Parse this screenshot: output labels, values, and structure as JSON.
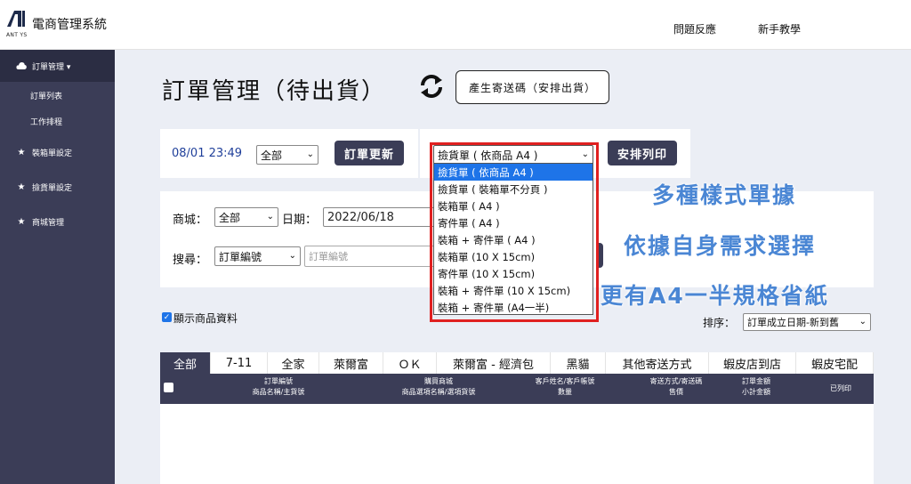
{
  "app": {
    "title": "電商管理系統",
    "logo_sub": "ANT YS",
    "top_links": [
      "問題反應",
      "新手教學"
    ]
  },
  "sidebar": {
    "items": [
      {
        "label": "訂單管理 ▾",
        "icon": "cloud-icon"
      },
      {
        "label": "訂單列表"
      },
      {
        "label": "工作排程"
      },
      {
        "label": "裝箱單設定",
        "icon": "star-icon"
      },
      {
        "label": "撿貨單設定",
        "icon": "star-icon"
      },
      {
        "label": "商城管理",
        "icon": "star-icon"
      }
    ]
  },
  "page": {
    "title": "訂單管理（待出貨）",
    "generate_button": "產生寄送碼（安排出貨）"
  },
  "update_panel": {
    "time": "08/01 23:49",
    "filter_value": "全部",
    "update_button": "訂單更新",
    "sheet_select_value": "撿貨單 ( 依商品 A4 )",
    "print_button": "安排列印"
  },
  "sheet_options": [
    "撿貨單 ( 依商品 A4 )",
    "撿貨單 ( 裝箱單不分頁 )",
    "裝箱單 ( A4 )",
    "寄件單 ( A4 )",
    "裝箱 + 寄件單 ( A4 )",
    "裝箱單 (10 X 15cm)",
    "寄件單 (10 X 15cm)",
    "裝箱 + 寄件單 (10 X 15cm)",
    "裝箱 + 寄件單 (A4一半)"
  ],
  "filter_panel": {
    "store_label": "商城：",
    "store_value": "全部",
    "date_label": "日期：",
    "date_value": "2022/06/18",
    "search_label": "搜尋：",
    "search_field_value": "訂單編號",
    "search_placeholder": "訂單編號"
  },
  "annotations": [
    "多種樣式單據",
    "依據自身需求選擇",
    "更有A4一半規格省紙"
  ],
  "options": {
    "show_product_label": "顯示商品資料",
    "sort_label": "排序：",
    "sort_value": "訂單成立日期-新到舊"
  },
  "tabs": [
    "全部",
    "7-11",
    "全家",
    "萊爾富",
    "ＯＫ",
    "萊爾富 - 經濟包",
    "黑貓",
    "其他寄送方式",
    "蝦皮店到店",
    "蝦皮宅配"
  ],
  "table": {
    "headers": [
      {
        "line1": "訂單編號",
        "line2": "商品名稱/主貨號"
      },
      {
        "line1": "購買商城",
        "line2": "商品選項名稱/選項貨號"
      },
      {
        "line1": "客戶姓名/客戶帳號",
        "line2": "數量"
      },
      {
        "line1": "寄送方式/寄送碼",
        "line2": "售價"
      },
      {
        "line1": "訂單金額",
        "line2": "小計金額"
      },
      {
        "line1": "已列印",
        "line2": ""
      }
    ]
  }
}
